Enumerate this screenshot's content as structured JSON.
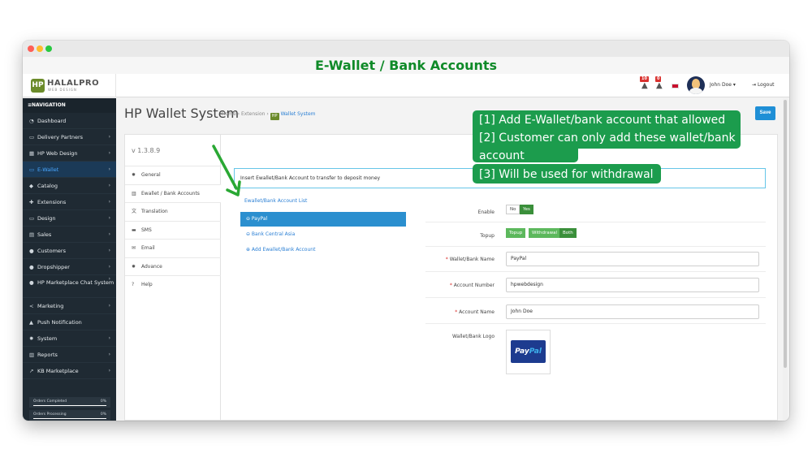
{
  "banner_title": "E-Wallet / Bank Accounts",
  "topbar": {
    "logo_text": "HALALPRO",
    "logo_sub": "WEB DESIGN",
    "logo_mark": "HP",
    "notif_badges": [
      "10",
      "0"
    ],
    "user_name": "John Doe ▾",
    "logout_label": "Logout"
  },
  "sidebar": {
    "heading": "NAVIGATION",
    "items": [
      {
        "label": "Dashboard",
        "icon": "dashboard-icon",
        "glyph": "◔",
        "chevron": false
      },
      {
        "label": "Delivery Partners",
        "icon": "truck-icon",
        "glyph": "▭",
        "chevron": true
      },
      {
        "label": "HP Web Design",
        "icon": "grid-icon",
        "glyph": "▦",
        "chevron": true
      },
      {
        "label": "E-Wallet",
        "icon": "wallet-icon",
        "glyph": "▭",
        "chevron": true,
        "active": true
      },
      {
        "label": "Catalog",
        "icon": "tag-icon",
        "glyph": "◆",
        "chevron": true
      },
      {
        "label": "Extensions",
        "icon": "puzzle-icon",
        "glyph": "✚",
        "chevron": true
      },
      {
        "label": "Design",
        "icon": "monitor-icon",
        "glyph": "▭",
        "chevron": true
      },
      {
        "label": "Sales",
        "icon": "cart-icon",
        "glyph": "▤",
        "chevron": true
      },
      {
        "label": "Customers",
        "icon": "user-icon",
        "glyph": "●",
        "chevron": true
      },
      {
        "label": "Dropshipper",
        "icon": "users-icon",
        "glyph": "●",
        "chevron": true
      },
      {
        "label": "HP Marketplace Chat System",
        "icon": "chat-icon",
        "glyph": "●",
        "chevron": true
      },
      {
        "label": "Marketing",
        "icon": "share-icon",
        "glyph": "<",
        "chevron": true
      },
      {
        "label": "Push Notification",
        "icon": "bell-icon",
        "glyph": "▲",
        "chevron": false
      },
      {
        "label": "System",
        "icon": "gear-icon",
        "glyph": "✹",
        "chevron": true
      },
      {
        "label": "Reports",
        "icon": "bar-chart-icon",
        "glyph": "▥",
        "chevron": true
      },
      {
        "label": "KB Marketplace",
        "icon": "line-chart-icon",
        "glyph": "↗",
        "chevron": true
      }
    ],
    "stats": [
      {
        "label": "Orders Completed",
        "value": "0%"
      },
      {
        "label": "Orders Processing",
        "value": "0%"
      }
    ]
  },
  "header": {
    "page_title": "HP Wallet System",
    "breadcrumb_home": "Home",
    "breadcrumb_sep": "›",
    "breadcrumb_ext": "Extension",
    "breadcrumb_badge": "HP",
    "breadcrumb_current": "Wallet System",
    "save_label": "Save"
  },
  "leftcol": {
    "version": "v 1.3.8.9",
    "tabs": [
      {
        "label": "General",
        "icon": "gear-icon",
        "glyph": "✹"
      },
      {
        "label": "Ewallet / Bank Accounts",
        "icon": "bank-icon",
        "glyph": "▥",
        "active": true
      },
      {
        "label": "Translation",
        "icon": "translate-icon",
        "glyph": "文"
      },
      {
        "label": "SMS",
        "icon": "sms-icon",
        "glyph": "▬"
      },
      {
        "label": "Email",
        "icon": "email-icon",
        "glyph": "✉"
      },
      {
        "label": "Advance",
        "icon": "cogs-icon",
        "glyph": "✹"
      },
      {
        "label": "Help",
        "icon": "help-icon",
        "glyph": "?"
      }
    ]
  },
  "content": {
    "insert_text": "Insert Ewallet/Bank Account to transfer to deposit money",
    "list_title": "Ewallet/Bank Account List",
    "list_items": [
      "⊖ PayPal",
      "⊖ Bank Central Asia"
    ],
    "add_label": "⊕ Add Ewallet/Bank Account",
    "form": {
      "enable_label": "Enable",
      "enable_no": "No",
      "enable_yes": "Yes",
      "topup_label": "Topup",
      "topup_options": [
        "Topup",
        "Withdrawal",
        "Both"
      ],
      "name_label": "Wallet/Bank Name",
      "name_value": "PayPal",
      "number_label": "Account Number",
      "number_value": "hpwebdesign",
      "account_label": "Account Name",
      "account_value": "John Doe",
      "logo_label": "Wallet/Bank Logo",
      "logo_word_a": "Pay",
      "logo_word_b": "Pal"
    }
  },
  "annotation": {
    "line1": "[1] Add E-Wallet/bank account that allowed",
    "line2": "[2] Customer can only add these wallet/bank",
    "line2b": "account",
    "line3": "[3] Will be used for withdrawal"
  },
  "colors": {
    "annotation_green": "#1c9c4d",
    "arrow_green": "#2aa834",
    "accent_blue": "#2b8fcf",
    "sidebar_bg": "#1f2a33"
  }
}
